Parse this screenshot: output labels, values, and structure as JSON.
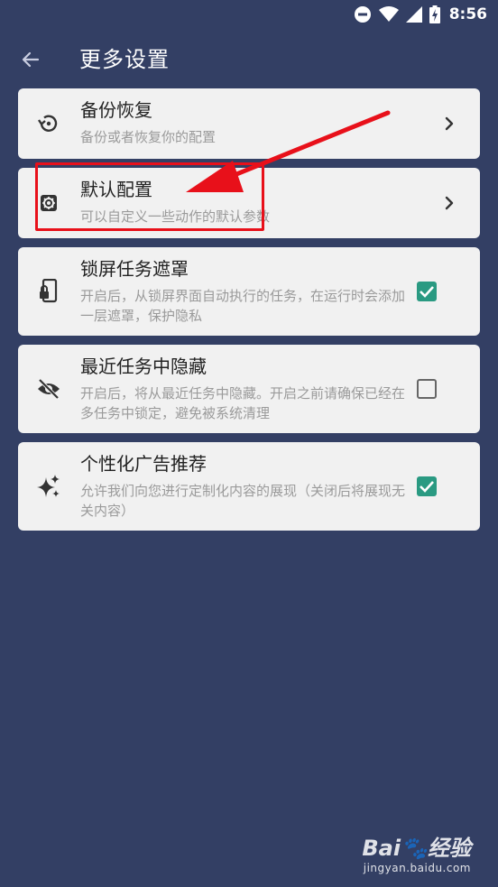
{
  "status_bar": {
    "time": "8:56"
  },
  "header": {
    "title": "更多设置"
  },
  "settings": [
    {
      "title": "备份恢复",
      "subtitle": "备份或者恢复你的配置",
      "icon": "restore-icon",
      "control": "chevron"
    },
    {
      "title": "默认配置",
      "subtitle": "可以自定义一些动作的默认参数",
      "icon": "gear-icon",
      "control": "chevron"
    },
    {
      "title": "锁屏任务遮罩",
      "subtitle": "开启后，从锁屏界面自动执行的任务，在运行时会添加一层遮罩，保护隐私",
      "icon": "lock-phone-icon",
      "control": "checkbox",
      "checked": true
    },
    {
      "title": "最近任务中隐藏",
      "subtitle": "开启后，将从最近任务中隐藏。开启之前请确保已经在多任务中锁定，避免被系统清理",
      "icon": "eye-off-icon",
      "control": "checkbox",
      "checked": false
    },
    {
      "title": "个性化广告推荐",
      "subtitle": "允许我们向您进行定制化内容的展现（关闭后将展现无关内容）",
      "icon": "sparkle-icon",
      "control": "checkbox",
      "checked": true
    }
  ],
  "annotation": {
    "color": "#e8101a"
  },
  "watermark": {
    "logo": "Bai🐾经验",
    "url": "jingyan.baidu.com"
  },
  "colors": {
    "background": "#333f64",
    "card": "#f1f1f1",
    "checkbox_on": "#2a9a82"
  }
}
